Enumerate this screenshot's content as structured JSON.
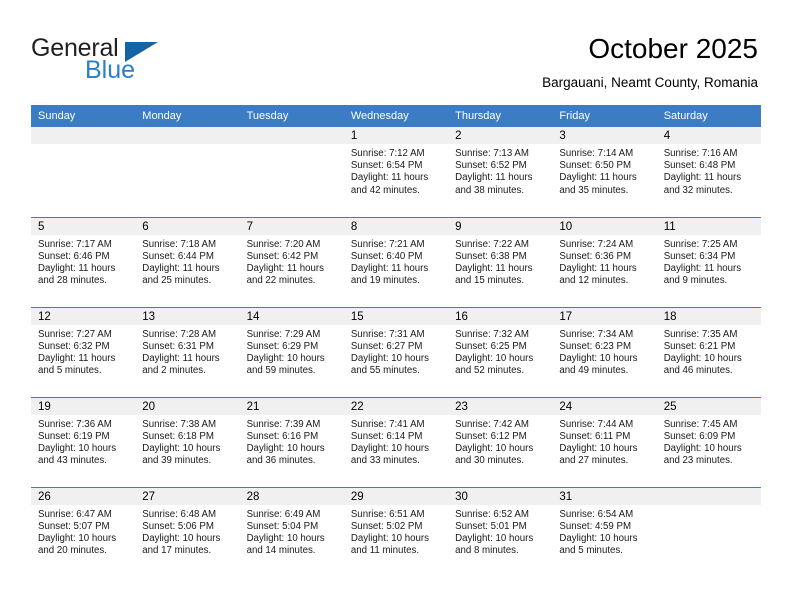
{
  "brand": {
    "word_one": "General",
    "word_two": "Blue",
    "logo_icon": "triangle-icon"
  },
  "header": {
    "title": "October 2025",
    "subtitle": "Bargauani, Neamt County, Romania"
  },
  "colors": {
    "header_blue": "#3b7cc4",
    "brand_blue": "#2a7fc9",
    "logo_blue": "#1463a5",
    "daynum_band": "#f0f0f0"
  },
  "labels": {
    "sunrise_prefix": "Sunrise:",
    "sunset_prefix": "Sunset:",
    "daylight_prefix": "Daylight:"
  },
  "weekday_headers": [
    "Sunday",
    "Monday",
    "Tuesday",
    "Wednesday",
    "Thursday",
    "Friday",
    "Saturday"
  ],
  "weeks": [
    [
      {
        "empty": true
      },
      {
        "empty": true
      },
      {
        "empty": true
      },
      {
        "day": "1",
        "sunrise": "Sunrise: 7:12 AM",
        "sunset": "Sunset: 6:54 PM",
        "daylight_l1": "Daylight: 11 hours",
        "daylight_l2": "and 42 minutes."
      },
      {
        "day": "2",
        "sunrise": "Sunrise: 7:13 AM",
        "sunset": "Sunset: 6:52 PM",
        "daylight_l1": "Daylight: 11 hours",
        "daylight_l2": "and 38 minutes."
      },
      {
        "day": "3",
        "sunrise": "Sunrise: 7:14 AM",
        "sunset": "Sunset: 6:50 PM",
        "daylight_l1": "Daylight: 11 hours",
        "daylight_l2": "and 35 minutes."
      },
      {
        "day": "4",
        "sunrise": "Sunrise: 7:16 AM",
        "sunset": "Sunset: 6:48 PM",
        "daylight_l1": "Daylight: 11 hours",
        "daylight_l2": "and 32 minutes."
      }
    ],
    [
      {
        "day": "5",
        "sunrise": "Sunrise: 7:17 AM",
        "sunset": "Sunset: 6:46 PM",
        "daylight_l1": "Daylight: 11 hours",
        "daylight_l2": "and 28 minutes."
      },
      {
        "day": "6",
        "sunrise": "Sunrise: 7:18 AM",
        "sunset": "Sunset: 6:44 PM",
        "daylight_l1": "Daylight: 11 hours",
        "daylight_l2": "and 25 minutes."
      },
      {
        "day": "7",
        "sunrise": "Sunrise: 7:20 AM",
        "sunset": "Sunset: 6:42 PM",
        "daylight_l1": "Daylight: 11 hours",
        "daylight_l2": "and 22 minutes."
      },
      {
        "day": "8",
        "sunrise": "Sunrise: 7:21 AM",
        "sunset": "Sunset: 6:40 PM",
        "daylight_l1": "Daylight: 11 hours",
        "daylight_l2": "and 19 minutes."
      },
      {
        "day": "9",
        "sunrise": "Sunrise: 7:22 AM",
        "sunset": "Sunset: 6:38 PM",
        "daylight_l1": "Daylight: 11 hours",
        "daylight_l2": "and 15 minutes."
      },
      {
        "day": "10",
        "sunrise": "Sunrise: 7:24 AM",
        "sunset": "Sunset: 6:36 PM",
        "daylight_l1": "Daylight: 11 hours",
        "daylight_l2": "and 12 minutes."
      },
      {
        "day": "11",
        "sunrise": "Sunrise: 7:25 AM",
        "sunset": "Sunset: 6:34 PM",
        "daylight_l1": "Daylight: 11 hours",
        "daylight_l2": "and 9 minutes."
      }
    ],
    [
      {
        "day": "12",
        "sunrise": "Sunrise: 7:27 AM",
        "sunset": "Sunset: 6:32 PM",
        "daylight_l1": "Daylight: 11 hours",
        "daylight_l2": "and 5 minutes."
      },
      {
        "day": "13",
        "sunrise": "Sunrise: 7:28 AM",
        "sunset": "Sunset: 6:31 PM",
        "daylight_l1": "Daylight: 11 hours",
        "daylight_l2": "and 2 minutes."
      },
      {
        "day": "14",
        "sunrise": "Sunrise: 7:29 AM",
        "sunset": "Sunset: 6:29 PM",
        "daylight_l1": "Daylight: 10 hours",
        "daylight_l2": "and 59 minutes."
      },
      {
        "day": "15",
        "sunrise": "Sunrise: 7:31 AM",
        "sunset": "Sunset: 6:27 PM",
        "daylight_l1": "Daylight: 10 hours",
        "daylight_l2": "and 55 minutes."
      },
      {
        "day": "16",
        "sunrise": "Sunrise: 7:32 AM",
        "sunset": "Sunset: 6:25 PM",
        "daylight_l1": "Daylight: 10 hours",
        "daylight_l2": "and 52 minutes."
      },
      {
        "day": "17",
        "sunrise": "Sunrise: 7:34 AM",
        "sunset": "Sunset: 6:23 PM",
        "daylight_l1": "Daylight: 10 hours",
        "daylight_l2": "and 49 minutes."
      },
      {
        "day": "18",
        "sunrise": "Sunrise: 7:35 AM",
        "sunset": "Sunset: 6:21 PM",
        "daylight_l1": "Daylight: 10 hours",
        "daylight_l2": "and 46 minutes."
      }
    ],
    [
      {
        "day": "19",
        "sunrise": "Sunrise: 7:36 AM",
        "sunset": "Sunset: 6:19 PM",
        "daylight_l1": "Daylight: 10 hours",
        "daylight_l2": "and 43 minutes."
      },
      {
        "day": "20",
        "sunrise": "Sunrise: 7:38 AM",
        "sunset": "Sunset: 6:18 PM",
        "daylight_l1": "Daylight: 10 hours",
        "daylight_l2": "and 39 minutes."
      },
      {
        "day": "21",
        "sunrise": "Sunrise: 7:39 AM",
        "sunset": "Sunset: 6:16 PM",
        "daylight_l1": "Daylight: 10 hours",
        "daylight_l2": "and 36 minutes."
      },
      {
        "day": "22",
        "sunrise": "Sunrise: 7:41 AM",
        "sunset": "Sunset: 6:14 PM",
        "daylight_l1": "Daylight: 10 hours",
        "daylight_l2": "and 33 minutes."
      },
      {
        "day": "23",
        "sunrise": "Sunrise: 7:42 AM",
        "sunset": "Sunset: 6:12 PM",
        "daylight_l1": "Daylight: 10 hours",
        "daylight_l2": "and 30 minutes."
      },
      {
        "day": "24",
        "sunrise": "Sunrise: 7:44 AM",
        "sunset": "Sunset: 6:11 PM",
        "daylight_l1": "Daylight: 10 hours",
        "daylight_l2": "and 27 minutes."
      },
      {
        "day": "25",
        "sunrise": "Sunrise: 7:45 AM",
        "sunset": "Sunset: 6:09 PM",
        "daylight_l1": "Daylight: 10 hours",
        "daylight_l2": "and 23 minutes."
      }
    ],
    [
      {
        "day": "26",
        "sunrise": "Sunrise: 6:47 AM",
        "sunset": "Sunset: 5:07 PM",
        "daylight_l1": "Daylight: 10 hours",
        "daylight_l2": "and 20 minutes."
      },
      {
        "day": "27",
        "sunrise": "Sunrise: 6:48 AM",
        "sunset": "Sunset: 5:06 PM",
        "daylight_l1": "Daylight: 10 hours",
        "daylight_l2": "and 17 minutes."
      },
      {
        "day": "28",
        "sunrise": "Sunrise: 6:49 AM",
        "sunset": "Sunset: 5:04 PM",
        "daylight_l1": "Daylight: 10 hours",
        "daylight_l2": "and 14 minutes."
      },
      {
        "day": "29",
        "sunrise": "Sunrise: 6:51 AM",
        "sunset": "Sunset: 5:02 PM",
        "daylight_l1": "Daylight: 10 hours",
        "daylight_l2": "and 11 minutes."
      },
      {
        "day": "30",
        "sunrise": "Sunrise: 6:52 AM",
        "sunset": "Sunset: 5:01 PM",
        "daylight_l1": "Daylight: 10 hours",
        "daylight_l2": "and 8 minutes."
      },
      {
        "day": "31",
        "sunrise": "Sunrise: 6:54 AM",
        "sunset": "Sunset: 4:59 PM",
        "daylight_l1": "Daylight: 10 hours",
        "daylight_l2": "and 5 minutes."
      },
      {
        "empty": true
      }
    ]
  ]
}
